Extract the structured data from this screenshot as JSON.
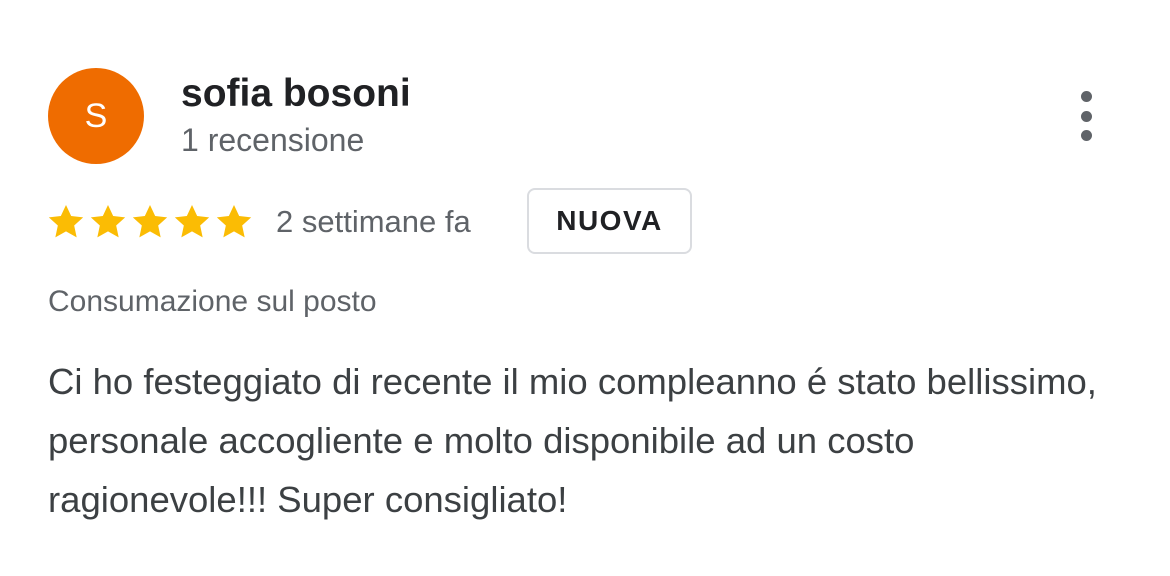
{
  "reviewer": {
    "avatar_letter": "S",
    "avatar_color": "#ef6c00",
    "name": "sofia bosoni",
    "review_count": "1 recensione"
  },
  "rating": {
    "stars": 5,
    "max_stars": 5,
    "star_color": "#fbbc04"
  },
  "review": {
    "time": "2 settimane fa",
    "badge": "NUOVA",
    "dining_mode": "Consumazione sul posto",
    "text": "Ci ho festeggiato di recente il mio compleanno é stato bellissimo, personale accogliente e molto disponibile ad un costo ragionevole!!! Super consigliato!"
  },
  "menu": {
    "icon": "more-vertical-icon"
  }
}
